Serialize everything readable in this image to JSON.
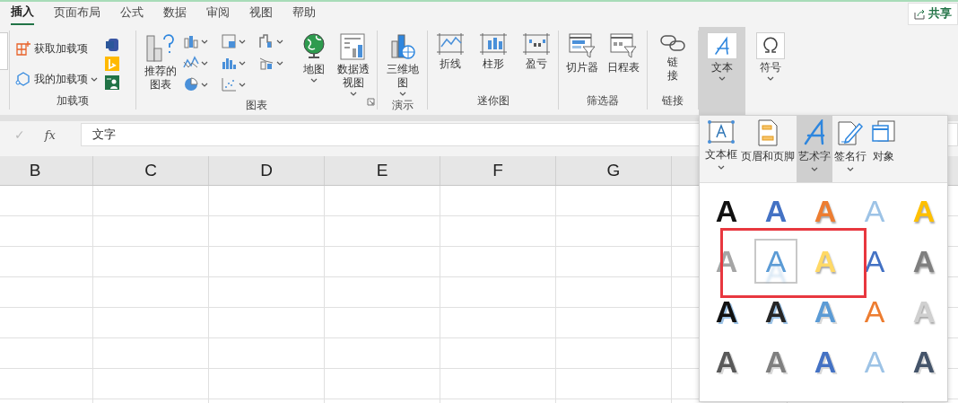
{
  "tabs": [
    {
      "label": "插入",
      "selected": true
    },
    {
      "label": "页面布局",
      "selected": false
    },
    {
      "label": "公式",
      "selected": false
    },
    {
      "label": "数据",
      "selected": false
    },
    {
      "label": "审阅",
      "selected": false
    },
    {
      "label": "视图",
      "selected": false
    },
    {
      "label": "帮助",
      "selected": false
    }
  ],
  "share_button": {
    "label": "共享"
  },
  "ribbon": {
    "addins": {
      "label": "加载项",
      "get_addins": "获取加载项",
      "my_addins": "我的加载项"
    },
    "charts": {
      "label": "图表",
      "recommended": "推荐的图表",
      "maps": "地图",
      "pivot_chart": "数据透视图"
    },
    "tours": {
      "label": "演示",
      "map3d": "三维地图"
    },
    "sparklines": {
      "label": "迷你图",
      "items": [
        "折线",
        "柱形",
        "盈亏"
      ]
    },
    "filters": {
      "label": "筛选器",
      "items": [
        "切片器",
        "日程表"
      ]
    },
    "links": {
      "label": "链接",
      "link": "链接"
    },
    "text": {
      "label": "文本",
      "expanded": true
    },
    "symbols": {
      "label": "符号"
    }
  },
  "formula_bar": {
    "enter_symbol": "✓",
    "function_symbol": "fx",
    "value": "文字"
  },
  "columns": [
    "B",
    "C",
    "D",
    "E",
    "F",
    "G"
  ],
  "text_menu": {
    "items": [
      {
        "label": "文本框",
        "has_menu": true,
        "selected": false
      },
      {
        "label": "页眉和页脚",
        "has_menu": false,
        "selected": false
      },
      {
        "label": "艺术字",
        "has_menu": true,
        "selected": true
      },
      {
        "label": "签名行",
        "has_menu": true,
        "selected": false
      },
      {
        "label": "对象",
        "has_menu": false,
        "selected": false
      }
    ],
    "wordart": [
      {
        "letter": "A",
        "kind": "fill",
        "color": "#111111",
        "selected": false
      },
      {
        "letter": "A",
        "kind": "fill",
        "color": "#4472c4",
        "selected": false
      },
      {
        "letter": "A",
        "kind": "gradient",
        "color": "#ed7d31",
        "selected": false
      },
      {
        "letter": "A",
        "kind": "outline",
        "color": "#9dc3e6",
        "selected": false
      },
      {
        "letter": "A",
        "kind": "gradient",
        "color": "#ffc000",
        "selected": false
      },
      {
        "letter": "A",
        "kind": "fill",
        "color": "#a5a5a5",
        "selected": false
      },
      {
        "letter": "A",
        "kind": "reflection",
        "color": "#5b9bd5",
        "selected": true
      },
      {
        "letter": "A",
        "kind": "gradient",
        "color": "#ffd966",
        "selected": false
      },
      {
        "letter": "A",
        "kind": "outline",
        "color": "#4472c4",
        "selected": false
      },
      {
        "letter": "A",
        "kind": "gradient",
        "color": "#7f7f7f",
        "selected": false
      },
      {
        "letter": "A",
        "kind": "shadow",
        "color": "#111111",
        "selected": false
      },
      {
        "letter": "A",
        "kind": "shadow",
        "color": "#262626",
        "selected": false
      },
      {
        "letter": "A",
        "kind": "pattern",
        "color": "#5b9bd5",
        "selected": false
      },
      {
        "letter": "A",
        "kind": "outline",
        "color": "#ed7d31",
        "selected": false
      },
      {
        "letter": "A",
        "kind": "gradient",
        "color": "#d0d0d0",
        "selected": false
      },
      {
        "letter": "A",
        "kind": "pattern",
        "color": "#595959",
        "selected": false
      },
      {
        "letter": "A",
        "kind": "pattern",
        "color": "#7f7f7f",
        "selected": false
      },
      {
        "letter": "A",
        "kind": "pattern",
        "color": "#4472c4",
        "selected": false
      },
      {
        "letter": "A",
        "kind": "outline",
        "color": "#9dc3e6",
        "selected": false
      },
      {
        "letter": "A",
        "kind": "pattern",
        "color": "#44546a",
        "selected": false
      }
    ],
    "annotation": {
      "kind": "rectangle"
    }
  }
}
